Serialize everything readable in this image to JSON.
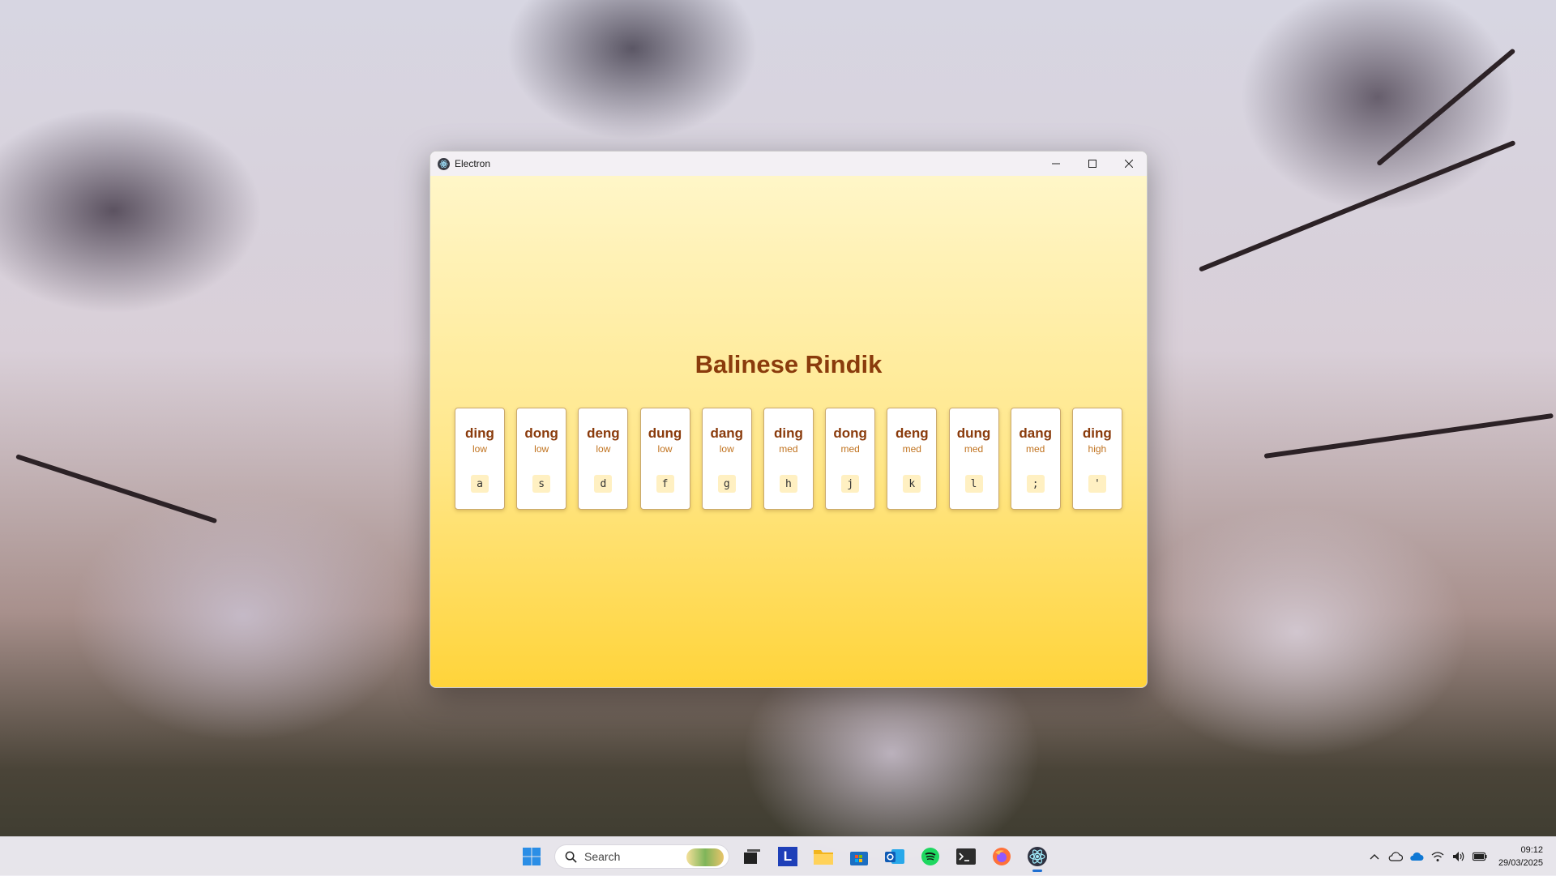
{
  "window": {
    "title": "Electron"
  },
  "app": {
    "heading": "Balinese Rindik",
    "keys": [
      {
        "note": "ding",
        "octave": "low",
        "key": "a"
      },
      {
        "note": "dong",
        "octave": "low",
        "key": "s"
      },
      {
        "note": "deng",
        "octave": "low",
        "key": "d"
      },
      {
        "note": "dung",
        "octave": "low",
        "key": "f"
      },
      {
        "note": "dang",
        "octave": "low",
        "key": "g"
      },
      {
        "note": "ding",
        "octave": "med",
        "key": "h"
      },
      {
        "note": "dong",
        "octave": "med",
        "key": "j"
      },
      {
        "note": "deng",
        "octave": "med",
        "key": "k"
      },
      {
        "note": "dung",
        "octave": "med",
        "key": "l"
      },
      {
        "note": "dang",
        "octave": "med",
        "key": ";"
      },
      {
        "note": "ding",
        "octave": "high",
        "key": "'"
      }
    ],
    "colors": {
      "heading": "#8a3b0c",
      "octave_label": "#c0721e",
      "background_top": "#fff6c8",
      "background_bottom": "#ffd43a"
    }
  },
  "taskbar": {
    "search_label": "Search",
    "pinned": [
      "start-icon",
      "search",
      "task-view-icon",
      "app-l-icon",
      "file-explorer-icon",
      "microsoft-store-icon",
      "outlook-icon",
      "spotify-icon",
      "terminal-icon",
      "firefox-icon",
      "electron-icon"
    ],
    "clock_time": "09:12",
    "clock_date": "29/03/2025"
  }
}
